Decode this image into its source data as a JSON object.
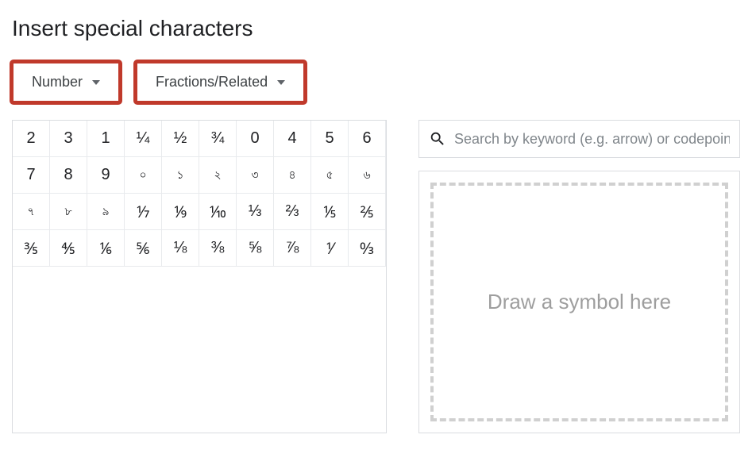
{
  "dialog": {
    "title": "Insert special characters"
  },
  "dropdowns": {
    "category": {
      "label": "Number"
    },
    "subcategory": {
      "label": "Fractions/Related"
    }
  },
  "grid": {
    "rows": [
      [
        "2",
        "3",
        "1",
        "¼",
        "½",
        "¾",
        "0",
        "4",
        "5",
        "6"
      ],
      [
        "7",
        "8",
        "9",
        "০",
        "১",
        "২",
        "৩",
        "৪",
        "৫",
        "৬"
      ],
      [
        "৭",
        "৮",
        "৯",
        "⅐",
        "⅑",
        "⅒",
        "⅓",
        "⅔",
        "⅕",
        "⅖"
      ],
      [
        "⅗",
        "⅘",
        "⅙",
        "⅚",
        "⅛",
        "⅜",
        "⅝",
        "⅞",
        "⅟",
        "↉"
      ]
    ]
  },
  "search": {
    "placeholder": "Search by keyword (e.g. arrow) or codepoint"
  },
  "draw": {
    "label": "Draw a symbol here"
  }
}
